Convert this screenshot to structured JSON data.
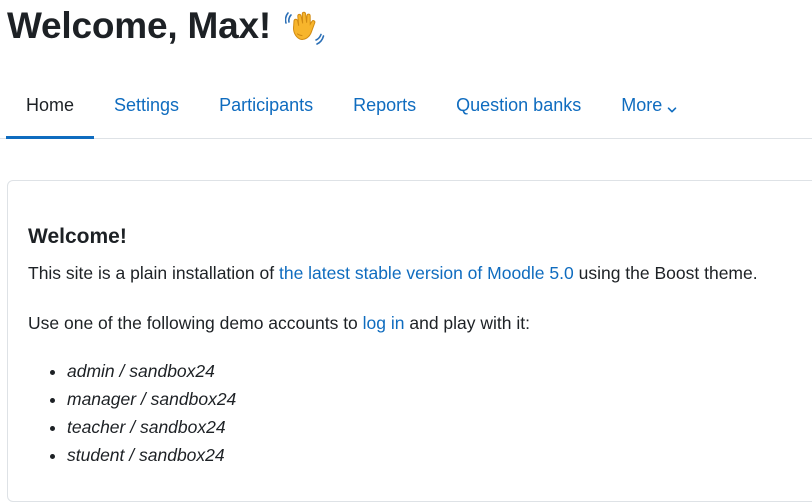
{
  "header": {
    "title": "Welcome, Max!",
    "wave_icon": "waving-hand-icon"
  },
  "nav": {
    "tabs": [
      {
        "label": "Home",
        "active": true
      },
      {
        "label": "Settings",
        "active": false
      },
      {
        "label": "Participants",
        "active": false
      },
      {
        "label": "Reports",
        "active": false
      },
      {
        "label": "Question banks",
        "active": false
      },
      {
        "label": "More",
        "active": false,
        "icon": "chevron-down-icon"
      }
    ]
  },
  "card": {
    "title": "Welcome!",
    "intro_before": "This site is a plain installation of ",
    "intro_link": "the latest stable version of Moodle 5.0",
    "intro_after": " using the Boost theme.",
    "accounts_before": "Use one of the following demo accounts to ",
    "accounts_link": "log in",
    "accounts_after": " and play with it:",
    "accounts": [
      "admin / sandbox24",
      "manager / sandbox24",
      "teacher / sandbox24",
      "student / sandbox24"
    ]
  },
  "colors": {
    "link": "#0f6cbf",
    "text": "#1d2125",
    "border": "#dee2e6"
  }
}
